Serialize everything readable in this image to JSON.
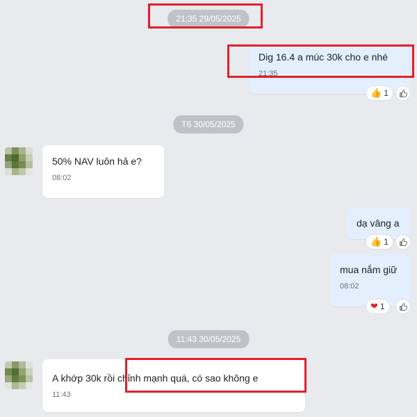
{
  "timestamps": {
    "first": "21:35 29/05/2025",
    "second": "T6 30/05/2025",
    "third": "11:43 30/05/2025"
  },
  "messages": [
    {
      "direction": "out",
      "text": "Dig 16.4 a múc 30k cho e nhé",
      "time": "21:35",
      "reaction": "thumbs-up",
      "reaction_count": "1"
    },
    {
      "direction": "in",
      "text": "50% NAV luôn hả e?",
      "time": "08:02"
    },
    {
      "direction": "out",
      "text": "dạ vâng a",
      "reaction": "thumbs-up",
      "reaction_count": "1"
    },
    {
      "direction": "out",
      "text": "mua nắm giữ",
      "time": "08:02",
      "reaction": "heart",
      "reaction_count": "1"
    },
    {
      "direction": "in",
      "text": "A khớp 30k rồi chỉnh mạnh quá, có sao không e",
      "time": "11:43"
    }
  ],
  "colors": {
    "background": "#e9eaee",
    "incoming_bubble": "#ffffff",
    "outgoing_bubble": "#e3effd",
    "timestamp_pill": "#bfc3c9",
    "highlight": "#e0202a"
  }
}
